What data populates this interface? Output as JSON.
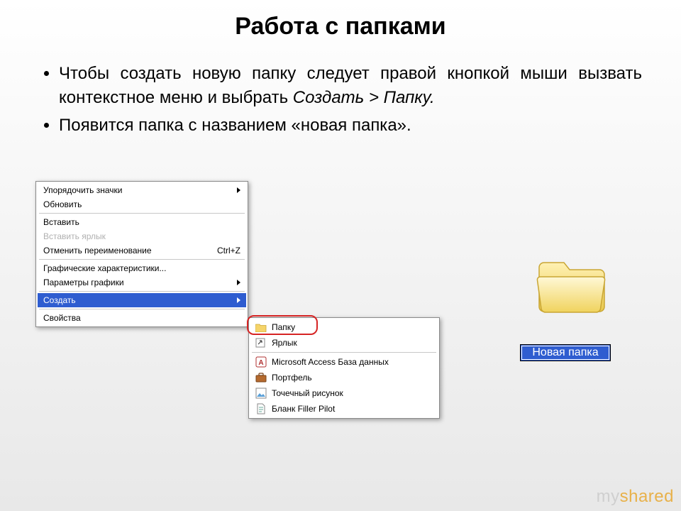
{
  "title": "Работа с папками",
  "bullet1_a": "Чтобы создать новую папку следует правой кнопкой мыши вызвать контекстное меню и выбрать ",
  "bullet1_b": "Создать > Папку.",
  "bullet2": "Появится папка с названием «новая папка».",
  "menu": {
    "arrange": "Упорядочить значки",
    "refresh": "Обновить",
    "paste": "Вставить",
    "paste_shortcut": "Вставить ярлык",
    "undo_rename": "Отменить переименование",
    "undo_shortcut": "Ctrl+Z",
    "gfx_chars": "Графические характеристики...",
    "gfx_params": "Параметры графики",
    "create": "Создать",
    "properties": "Свойства"
  },
  "submenu": {
    "folder": "Папку",
    "shortcut": "Ярлык",
    "access": "Microsoft Access База данных",
    "briefcase": "Портфель",
    "bitmap": "Точечный рисунок",
    "filler": "Бланк Filler Pilot"
  },
  "new_folder_label": "Новая папка",
  "watermark_a": "my",
  "watermark_b": "shared"
}
